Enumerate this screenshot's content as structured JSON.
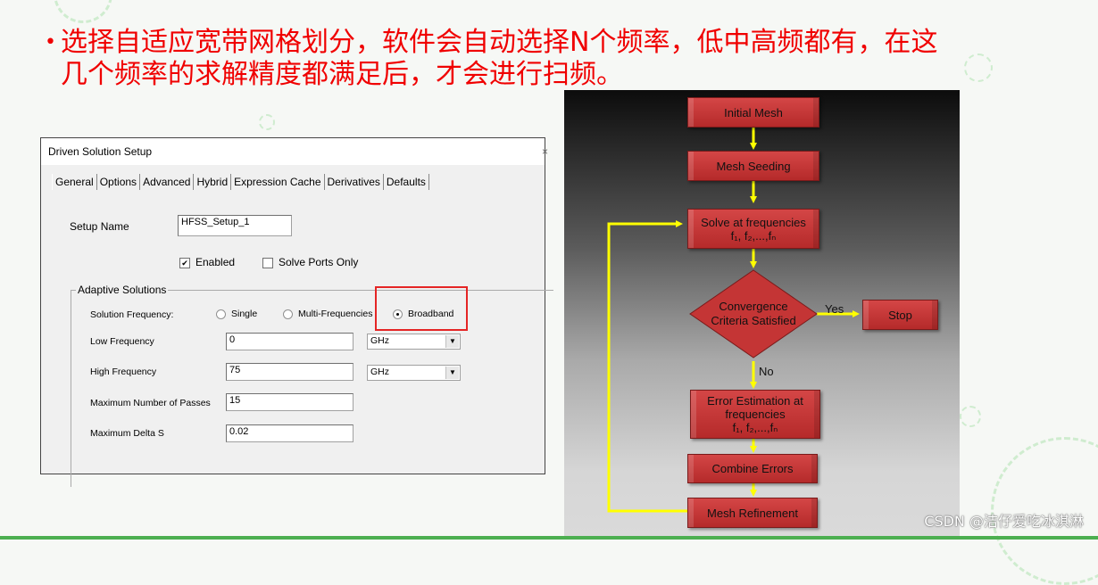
{
  "slide": {
    "bullet_line1": "选择自适应宽带网格划分，软件会自动选择N个频率，低中高频都有，在这",
    "bullet_line2": "几个频率的求解精度都满足后，才会进行扫频。",
    "bullet_glyph": "•",
    "text_color": "#f00000",
    "accent_color": "#4caf50"
  },
  "dialog": {
    "title": "Driven Solution Setup",
    "close_glyph": "×",
    "tabs": [
      {
        "label": "General",
        "active": true
      },
      {
        "label": "Options"
      },
      {
        "label": "Advanced"
      },
      {
        "label": "Hybrid"
      },
      {
        "label": "Expression Cache"
      },
      {
        "label": "Derivatives"
      },
      {
        "label": "Defaults"
      }
    ],
    "setup_name_label": "Setup Name",
    "setup_name_value": "HFSS_Setup_1",
    "enabled_label": "Enabled",
    "enabled_checked": true,
    "solve_ports_label": "Solve Ports Only",
    "solve_ports_checked": false,
    "adaptive_group_label": "Adaptive Solutions",
    "solution_frequency_label": "Solution Frequency:",
    "radio_options": [
      "Single",
      "Multi-Frequencies",
      "Broadband"
    ],
    "radio_selected": "Broadband",
    "low_freq_label": "Low Frequency",
    "low_freq_value": "0",
    "low_freq_unit": "GHz",
    "high_freq_label": "High Frequency",
    "high_freq_value": "75",
    "high_freq_unit": "GHz",
    "max_passes_label": "Maximum Number of Passes",
    "max_passes_value": "15",
    "max_delta_s_label": "Maximum Delta S",
    "max_delta_s_value": "0.02",
    "highlight_color": "#e52525"
  },
  "flowchart": {
    "nodes": {
      "initial_mesh": "Initial Mesh",
      "mesh_seeding": "Mesh Seeding",
      "solve_line1": "Solve at frequencies",
      "solve_line2": "f₁, f₂,...,fₙ",
      "decision_line1": "Convergence",
      "decision_line2": "Criteria Satisfied",
      "stop": "Stop",
      "error_line1": "Error Estimation at",
      "error_line2": "frequencies",
      "error_line3": "f₁, f₂,...,fₙ",
      "combine": "Combine Errors",
      "refine": "Mesh Refinement"
    },
    "yes_label": "Yes",
    "no_label": "No",
    "box_color": "#c43535",
    "arrow_color": "#ffff00"
  },
  "watermark": "CSDN @洁仔爱吃冰淇淋"
}
